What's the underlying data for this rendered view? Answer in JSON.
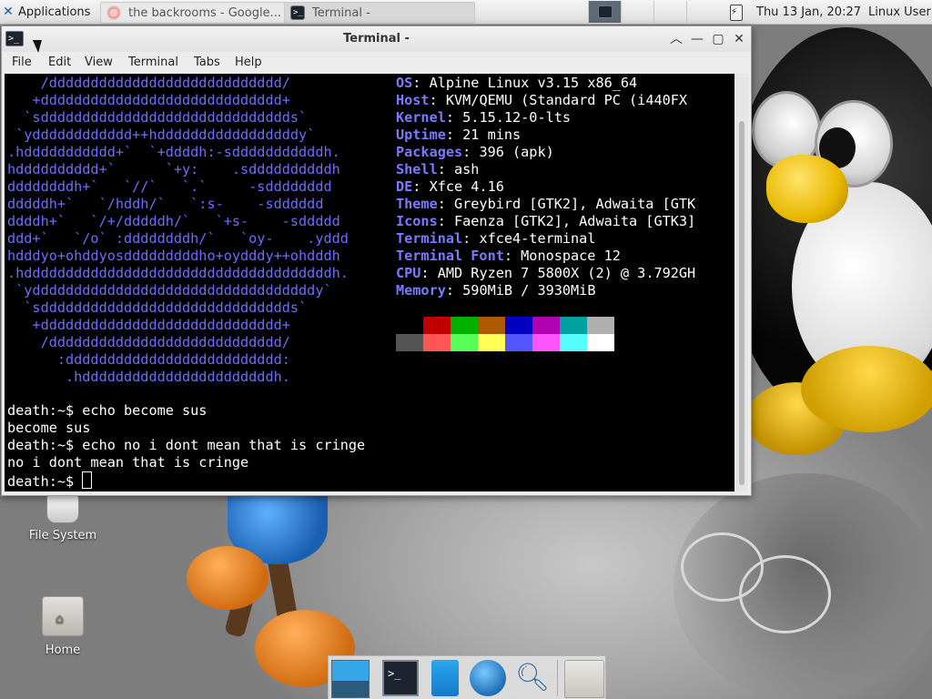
{
  "top_panel": {
    "applications_label": "Applications",
    "tasks": [
      {
        "title": "the backrooms - Google..."
      },
      {
        "title": "Terminal -"
      }
    ],
    "clock": "Thu 13 Jan, 20:27",
    "user": "Linux User"
  },
  "window": {
    "title": "Terminal -",
    "menu": [
      "File",
      "Edit",
      "View",
      "Terminal",
      "Tabs",
      "Help"
    ]
  },
  "terminal": {
    "logo_lines": [
      "    /dddddddddddddddddddddddddddd/",
      "   +ddddddddddddddddddddddddddddd+",
      "  `sdddddddddddddddddddddddddddddds`",
      " `ydddddddddddd++hdddddddddddddddddy`",
      ".hddddddddddd+`  `+ddddh:-sdddddddddddh.",
      "hdddddddddd+`      `+y:    .sddddddddddh",
      "ddddddddh+`   `//`   `.`     -sdddddddd",
      "dddddh+`   `/hddh/`   `:s-    -sdddddd",
      "ddddh+`   `/+/dddddh/`   `+s-    -sddddd",
      "ddd+`   `/o` :ddddddddh/`   `oy-    .yddd",
      "hdddyo+ohddyosdddddddddho+oydddy++ohdddh",
      ".hdddddddddddddddddddddddddddddddddddddh.",
      " `yddddddddddddddddddddddddddddddddddy`",
      "  `sdddddddddddddddddddddddddddddds`",
      "   +ddddddddddddddddddddddddddddd+",
      "    /dddddddddddddddddddddddddddd/",
      "      :dddddddddddddddddddddddddd:",
      "       .hdddddddddddddddddddddddh."
    ],
    "info": [
      {
        "key": "OS",
        "value": "Alpine Linux v3.15 x86_64"
      },
      {
        "key": "Host",
        "value": "KVM/QEMU (Standard PC (i440FX"
      },
      {
        "key": "Kernel",
        "value": "5.15.12-0-lts"
      },
      {
        "key": "Uptime",
        "value": "21 mins"
      },
      {
        "key": "Packages",
        "value": "396 (apk)"
      },
      {
        "key": "Shell",
        "value": "ash"
      },
      {
        "key": "DE",
        "value": "Xfce 4.16"
      },
      {
        "key": "Theme",
        "value": "Greybird [GTK2], Adwaita [GTK"
      },
      {
        "key": "Icons",
        "value": "Faenza [GTK2], Adwaita [GTK3]"
      },
      {
        "key": "Terminal",
        "value": "xfce4-terminal"
      },
      {
        "key": "Terminal Font",
        "value": "Monospace 12"
      },
      {
        "key": "CPU",
        "value": "AMD Ryzen 7 5800X (2) @ 3.792GH"
      },
      {
        "key": "Memory",
        "value": "590MiB / 3930MiB"
      }
    ],
    "swatches_top": [
      "#000000",
      "#c00000",
      "#00b000",
      "#b05a00",
      "#0000c0",
      "#b000b0",
      "#00a0a0",
      "#b0b0b0"
    ],
    "swatches_bottom": [
      "#555555",
      "#ff5555",
      "#55ff55",
      "#ffff55",
      "#5555ff",
      "#ff55ff",
      "#55ffff",
      "#ffffff"
    ],
    "session": [
      "death:~$ echo become sus",
      "become sus",
      "death:~$ echo no i dont mean that is cringe",
      "no i dont mean that is cringe"
    ],
    "prompt": "death:~$ "
  },
  "desktop_icons": {
    "file_system": "File System",
    "home": "Home"
  }
}
